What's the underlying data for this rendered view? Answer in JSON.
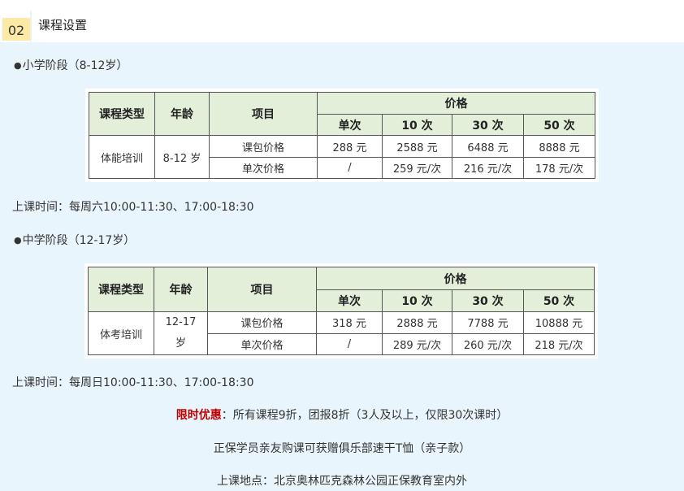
{
  "header": {
    "number": "02",
    "title": "课程设置"
  },
  "primary": {
    "heading": "小学阶段（8-12岁）",
    "cols": {
      "type": "课程类型",
      "age": "年龄",
      "item": "项目",
      "price": "价格"
    },
    "sub": [
      "单次",
      "10 次",
      "30 次",
      "50 次"
    ],
    "course_type": "体能培训",
    "age": "8-12 岁",
    "rows": [
      {
        "label": "课包价格",
        "values": [
          "288 元",
          "2588 元",
          "6488 元",
          "8888 元"
        ]
      },
      {
        "label": "单次价格",
        "values": [
          "/",
          "259 元/次",
          "216 元/次",
          "178 元/次"
        ]
      }
    ],
    "schedule": "上课时间：每周六10:00-11:30、17:00-18:30"
  },
  "middle": {
    "heading": "中学阶段（12-17岁）",
    "cols": {
      "type": "课程类型",
      "age": "年龄",
      "item": "项目",
      "price": "价格"
    },
    "sub": [
      "单次",
      "10 次",
      "30 次",
      "50 次"
    ],
    "course_type": "体考培训",
    "age_line1": "12-17",
    "age_line2": "岁",
    "rows": [
      {
        "label": "课包价格",
        "values": [
          "318 元",
          "2888 元",
          "7788 元",
          "10888 元"
        ]
      },
      {
        "label": "单次价格",
        "values": [
          "/",
          "289 元/次",
          "260 元/次",
          "218 元/次"
        ]
      }
    ],
    "schedule": "上课时间：每周日10:00-11:30、17:00-18:30"
  },
  "promo": {
    "label": "限时优惠",
    "text": "：所有课程9折，团报8折（3人及以上，仅限30次课时）"
  },
  "gift": "正保学员亲友购课可获赠俱乐部速干T恤（亲子款）",
  "location": "上课地点：北京奥林匹克森林公园正保教育室内外"
}
